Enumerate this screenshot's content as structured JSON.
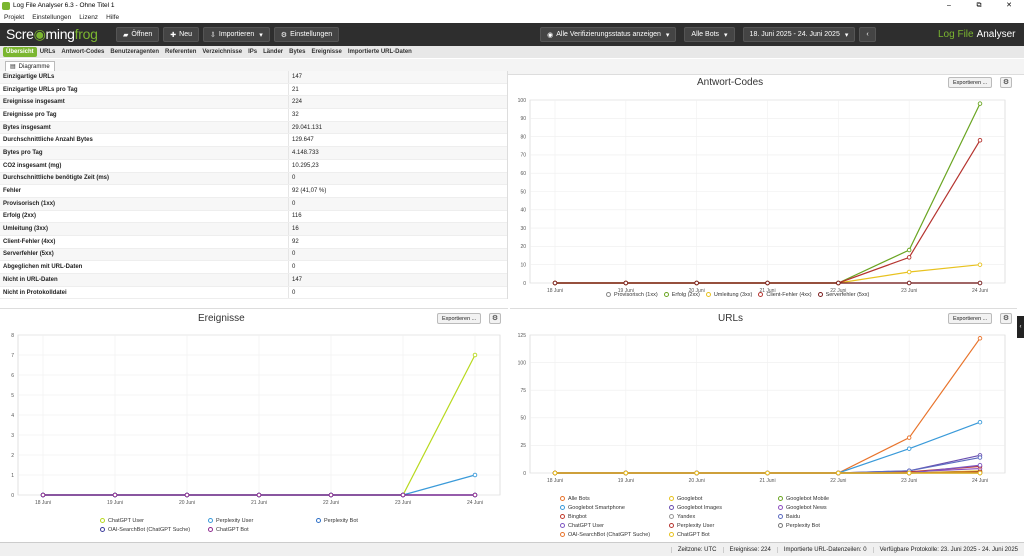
{
  "window": {
    "title": "Log File Analyser 6.3 - Ohne Titel 1",
    "min": "–",
    "restore": "⧉",
    "close": "✕"
  },
  "menu": [
    "Projekt",
    "Einstellungen",
    "Lizenz",
    "Hilfe"
  ],
  "toolbar": {
    "logo_a": "Scre",
    "logo_b": "ming",
    "logo_c": "frog",
    "open": "Öffnen",
    "new": "Neu",
    "import": "Importieren",
    "settings": "Einstellungen",
    "verify": "Alle Verifizierungsstatus anzeigen",
    "bots": "Alle Bots",
    "daterange": "18. Juni 2025 - 24. Juni 2025",
    "prev": "‹",
    "brand_a": "Log File",
    "brand_b": "Analyser"
  },
  "tabs": [
    "Übersicht",
    "URLs",
    "Antwort-Codes",
    "Benutzeragenten",
    "Referenten",
    "Verzeichnisse",
    "IPs",
    "Länder",
    "Bytes",
    "Ereignisse",
    "Importierte URL-Daten"
  ],
  "sub_button": "Diagramme",
  "stats": [
    {
      "k": "Einzigartige URLs",
      "v": "147"
    },
    {
      "k": "Einzigartige URLs pro Tag",
      "v": "21"
    },
    {
      "k": "Ereignisse insgesamt",
      "v": "224"
    },
    {
      "k": "Ereignisse pro Tag",
      "v": "32"
    },
    {
      "k": "Bytes insgesamt",
      "v": "29.041.131"
    },
    {
      "k": "Durchschnittliche Anzahl Bytes",
      "v": "129.647"
    },
    {
      "k": "Bytes pro Tag",
      "v": "4.148.733"
    },
    {
      "k": "CO2 insgesamt (mg)",
      "v": "10.295,23"
    },
    {
      "k": "Durchschnittliche benötigte Zeit (ms)",
      "v": "0"
    },
    {
      "k": "Fehler",
      "v": "92 (41,07 %)"
    },
    {
      "k": "Provisorisch (1xx)",
      "v": "0"
    },
    {
      "k": "Erfolg (2xx)",
      "v": "116"
    },
    {
      "k": "Umleitung (3xx)",
      "v": "16"
    },
    {
      "k": "Client-Fehler (4xx)",
      "v": "92"
    },
    {
      "k": "Serverfehler (5xx)",
      "v": "0"
    },
    {
      "k": "Abgeglichen mit URL-Daten",
      "v": "0"
    },
    {
      "k": "Nicht in URL-Daten",
      "v": "147"
    },
    {
      "k": "Nicht in Protokolldatei",
      "v": "0"
    }
  ],
  "export_label": "Exportieren ...",
  "gear_icon": "gear-icon",
  "chart_data": [
    {
      "title": "Antwort-Codes",
      "type": "line",
      "x": [
        "18 Juni",
        "19 Juni",
        "20 Juni",
        "21 Juni",
        "22 Juni",
        "23 Juni",
        "24 Juni"
      ],
      "ylim": [
        0,
        100
      ],
      "yticks": [
        0,
        10,
        20,
        30,
        40,
        50,
        60,
        70,
        80,
        90,
        100
      ],
      "series": [
        {
          "name": "Provisorisch (1xx)",
          "color": "#888888",
          "values": [
            0,
            0,
            0,
            0,
            0,
            0,
            0
          ]
        },
        {
          "name": "Erfolg (2xx)",
          "color": "#6aa522",
          "values": [
            0,
            0,
            0,
            0,
            0,
            18,
            98
          ]
        },
        {
          "name": "Umleitung (3xx)",
          "color": "#e8c21f",
          "values": [
            0,
            0,
            0,
            0,
            0,
            6,
            10
          ]
        },
        {
          "name": "Client-Fehler (4xx)",
          "color": "#b5342f",
          "values": [
            0,
            0,
            0,
            0,
            0,
            14,
            78
          ]
        },
        {
          "name": "Serverfehler (5xx)",
          "color": "#7a1e1e",
          "values": [
            0,
            0,
            0,
            0,
            0,
            0,
            0
          ]
        }
      ]
    },
    {
      "title": "Ereignisse",
      "type": "line",
      "x": [
        "18 Juni",
        "19 Juni",
        "20 Juni",
        "21 Juni",
        "22 Juni",
        "23 Juni",
        "24 Juni"
      ],
      "ylim": [
        0,
        8
      ],
      "yticks": [
        0,
        1,
        2,
        3,
        4,
        5,
        6,
        7,
        8
      ],
      "series": [
        {
          "name": "ChatGPT User",
          "color": "#b8d91f",
          "values": [
            0,
            0,
            0,
            0,
            0,
            0,
            7
          ]
        },
        {
          "name": "Perplexity User",
          "color": "#3a9ad9",
          "values": [
            0,
            0,
            0,
            0,
            0,
            0,
            1
          ]
        },
        {
          "name": "Perplexity Bot",
          "color": "#2d6fc7",
          "values": [
            0,
            0,
            0,
            0,
            0,
            0,
            0
          ]
        },
        {
          "name": "OAI-SearchBot (ChatGPT Suche)",
          "color": "#3b3b9c",
          "values": [
            0,
            0,
            0,
            0,
            0,
            0,
            0
          ]
        },
        {
          "name": "ChatGPT Bot",
          "color": "#8e2a8e",
          "values": [
            0,
            0,
            0,
            0,
            0,
            0,
            0
          ]
        }
      ]
    },
    {
      "title": "URLs",
      "type": "line",
      "x": [
        "18 Juni",
        "19 Juni",
        "20 Juni",
        "21 Juni",
        "22 Juni",
        "23 Juni",
        "24 Juni"
      ],
      "ylim": [
        0,
        125
      ],
      "yticks": [
        0,
        25,
        50,
        75,
        100,
        125
      ],
      "series": [
        {
          "name": "Alle Bots",
          "color": "#e8742c",
          "values": [
            0,
            0,
            0,
            0,
            0,
            32,
            122
          ]
        },
        {
          "name": "Googlebot",
          "color": "#e8c21f",
          "values": [
            0,
            0,
            0,
            0,
            0,
            0,
            2
          ]
        },
        {
          "name": "Googlebot Mobile",
          "color": "#6aa522",
          "values": [
            0,
            0,
            0,
            0,
            0,
            0,
            1
          ]
        },
        {
          "name": "Googlebot Smartphone",
          "color": "#3a9ad9",
          "values": [
            0,
            0,
            0,
            0,
            0,
            22,
            46
          ]
        },
        {
          "name": "Googlebot Images",
          "color": "#6a4fb0",
          "values": [
            0,
            0,
            0,
            0,
            0,
            2,
            16
          ]
        },
        {
          "name": "Googlebot News",
          "color": "#8e4fc0",
          "values": [
            0,
            0,
            0,
            0,
            0,
            1,
            4
          ]
        },
        {
          "name": "Bingbot",
          "color": "#c0392b",
          "values": [
            0,
            0,
            0,
            0,
            0,
            1,
            6
          ]
        },
        {
          "name": "Yandex",
          "color": "#999999",
          "values": [
            0,
            0,
            0,
            0,
            0,
            0,
            0
          ]
        },
        {
          "name": "Baidu",
          "color": "#5c6bc0",
          "values": [
            0,
            0,
            0,
            0,
            0,
            2,
            14
          ]
        },
        {
          "name": "ChatGPT User",
          "color": "#7e57c2",
          "values": [
            0,
            0,
            0,
            0,
            0,
            0,
            7
          ]
        },
        {
          "name": "Perplexity User",
          "color": "#b5342f",
          "values": [
            0,
            0,
            0,
            0,
            0,
            0,
            1
          ]
        },
        {
          "name": "Perplexity Bot",
          "color": "#777777",
          "values": [
            0,
            0,
            0,
            0,
            0,
            0,
            0
          ]
        },
        {
          "name": "OAI-SearchBot (ChatGPT Suche)",
          "color": "#e8742c",
          "values": [
            0,
            0,
            0,
            0,
            0,
            0,
            0
          ]
        },
        {
          "name": "ChatGPT Bot",
          "color": "#e8c21f",
          "values": [
            0,
            0,
            0,
            0,
            0,
            0,
            0
          ]
        }
      ]
    }
  ],
  "status": {
    "tz": "Zeitzone:  UTC",
    "events": "Ereignisse:  224",
    "imported": "Importierte URL-Datenzeilen:  0",
    "available": "Verfügbare Protokolle:  23. Juni 2025 - 24. Juni 2025"
  }
}
